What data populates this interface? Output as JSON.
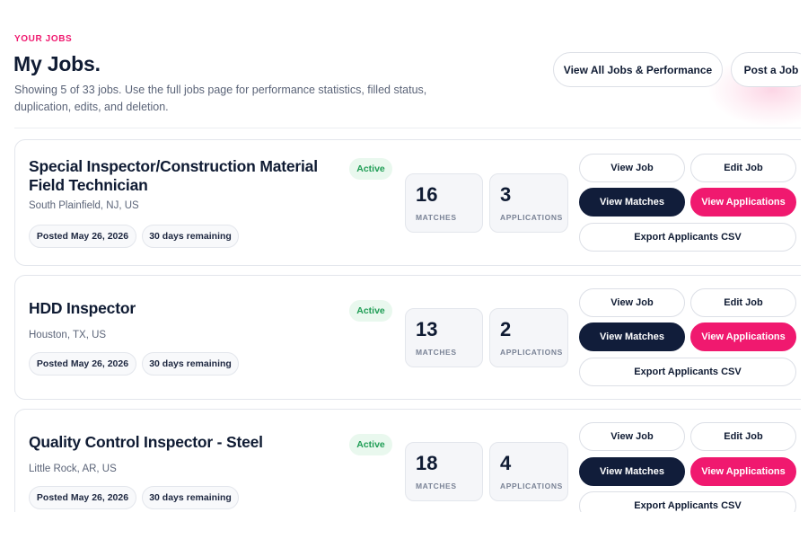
{
  "header": {
    "eyebrow": "YOUR JOBS",
    "title": "My Jobs.",
    "subtitle": "Showing 5 of 33 jobs. Use the full jobs page for performance statistics, filled status, duplication, edits, and deletion.",
    "view_all_label": "View All Jobs & Performance",
    "post_job_label": "Post a Job"
  },
  "colors": {
    "accent": "#f0196f",
    "dark": "#111d3a",
    "active_green": "#1f9d55"
  },
  "jobs": [
    {
      "title": "Special Inspector/Construction Material Field Technician",
      "location": "South Plainfield, NJ, US",
      "posted": "Posted May 26, 2026",
      "remaining": "30 days remaining",
      "status": "Active",
      "matches": "16",
      "matches_label": "MATCHES",
      "applications": "3",
      "applications_label": "APPLICATIONS",
      "view_job": "View Job",
      "edit_job": "Edit Job",
      "view_matches": "View Matches",
      "view_applications": "View Applications",
      "export_csv": "Export Applicants CSV"
    },
    {
      "title": "HDD Inspector",
      "location": "Houston, TX, US",
      "posted": "Posted May 26, 2026",
      "remaining": "30 days remaining",
      "status": "Active",
      "matches": "13",
      "matches_label": "MATCHES",
      "applications": "2",
      "applications_label": "APPLICATIONS",
      "view_job": "View Job",
      "edit_job": "Edit Job",
      "view_matches": "View Matches",
      "view_applications": "View Applications",
      "export_csv": "Export Applicants CSV"
    },
    {
      "title": "Quality Control Inspector - Steel",
      "location": "Little Rock, AR, US",
      "posted": "Posted May 26, 2026",
      "remaining": "30 days remaining",
      "status": "Active",
      "matches": "18",
      "matches_label": "MATCHES",
      "applications": "4",
      "applications_label": "APPLICATIONS",
      "view_job": "View Job",
      "edit_job": "Edit Job",
      "view_matches": "View Matches",
      "view_applications": "View Applications",
      "export_csv": "Export Applicants CSV"
    }
  ]
}
